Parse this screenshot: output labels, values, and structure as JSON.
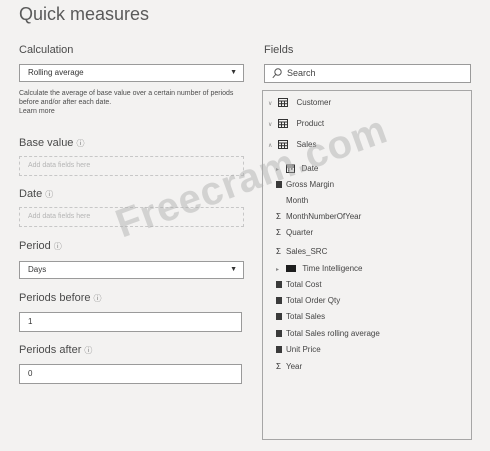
{
  "header": {
    "title": "Quick measures"
  },
  "left": {
    "calculation_label": "Calculation",
    "calculation_value": "Rolling average",
    "description": "Calculate the average of base value over a certain number of periods before and/or after each date.",
    "learn_more": "Learn more",
    "base_value_label": "Base value",
    "base_value_placeholder": "Add data fields here",
    "date_label": "Date",
    "date_placeholder": "Add data fields here",
    "period_label": "Period",
    "period_value": "Days",
    "periods_before_label": "Periods before",
    "periods_before_value": "1",
    "periods_after_label": "Periods after",
    "periods_after_value": "0"
  },
  "right": {
    "fields_label": "Fields",
    "search_placeholder": "Search",
    "items": [
      {
        "label": "Customer",
        "kind": "table",
        "state": "collapsed"
      },
      {
        "label": "Product",
        "kind": "table",
        "state": "collapsed"
      },
      {
        "label": "Sales",
        "kind": "table",
        "state": "expanded"
      },
      {
        "label": "Date",
        "kind": "calendar"
      },
      {
        "label": "Gross Margin",
        "kind": "measure"
      },
      {
        "label": "Month",
        "kind": "field"
      },
      {
        "label": "MonthNumberOfYear",
        "kind": "sum"
      },
      {
        "label": "Quarter",
        "kind": "sum"
      },
      {
        "label": "Sales_SRC",
        "kind": "sum"
      },
      {
        "label": "Time Intelligence",
        "kind": "folder"
      },
      {
        "label": "Total Cost",
        "kind": "measure"
      },
      {
        "label": "Total Order Qty",
        "kind": "measure"
      },
      {
        "label": "Total Sales",
        "kind": "measure"
      },
      {
        "label": "Total Sales rolling average",
        "kind": "measure"
      },
      {
        "label": "Unit Price",
        "kind": "measure"
      },
      {
        "label": "Year",
        "kind": "sum"
      }
    ]
  },
  "watermark": "Freecram.com"
}
